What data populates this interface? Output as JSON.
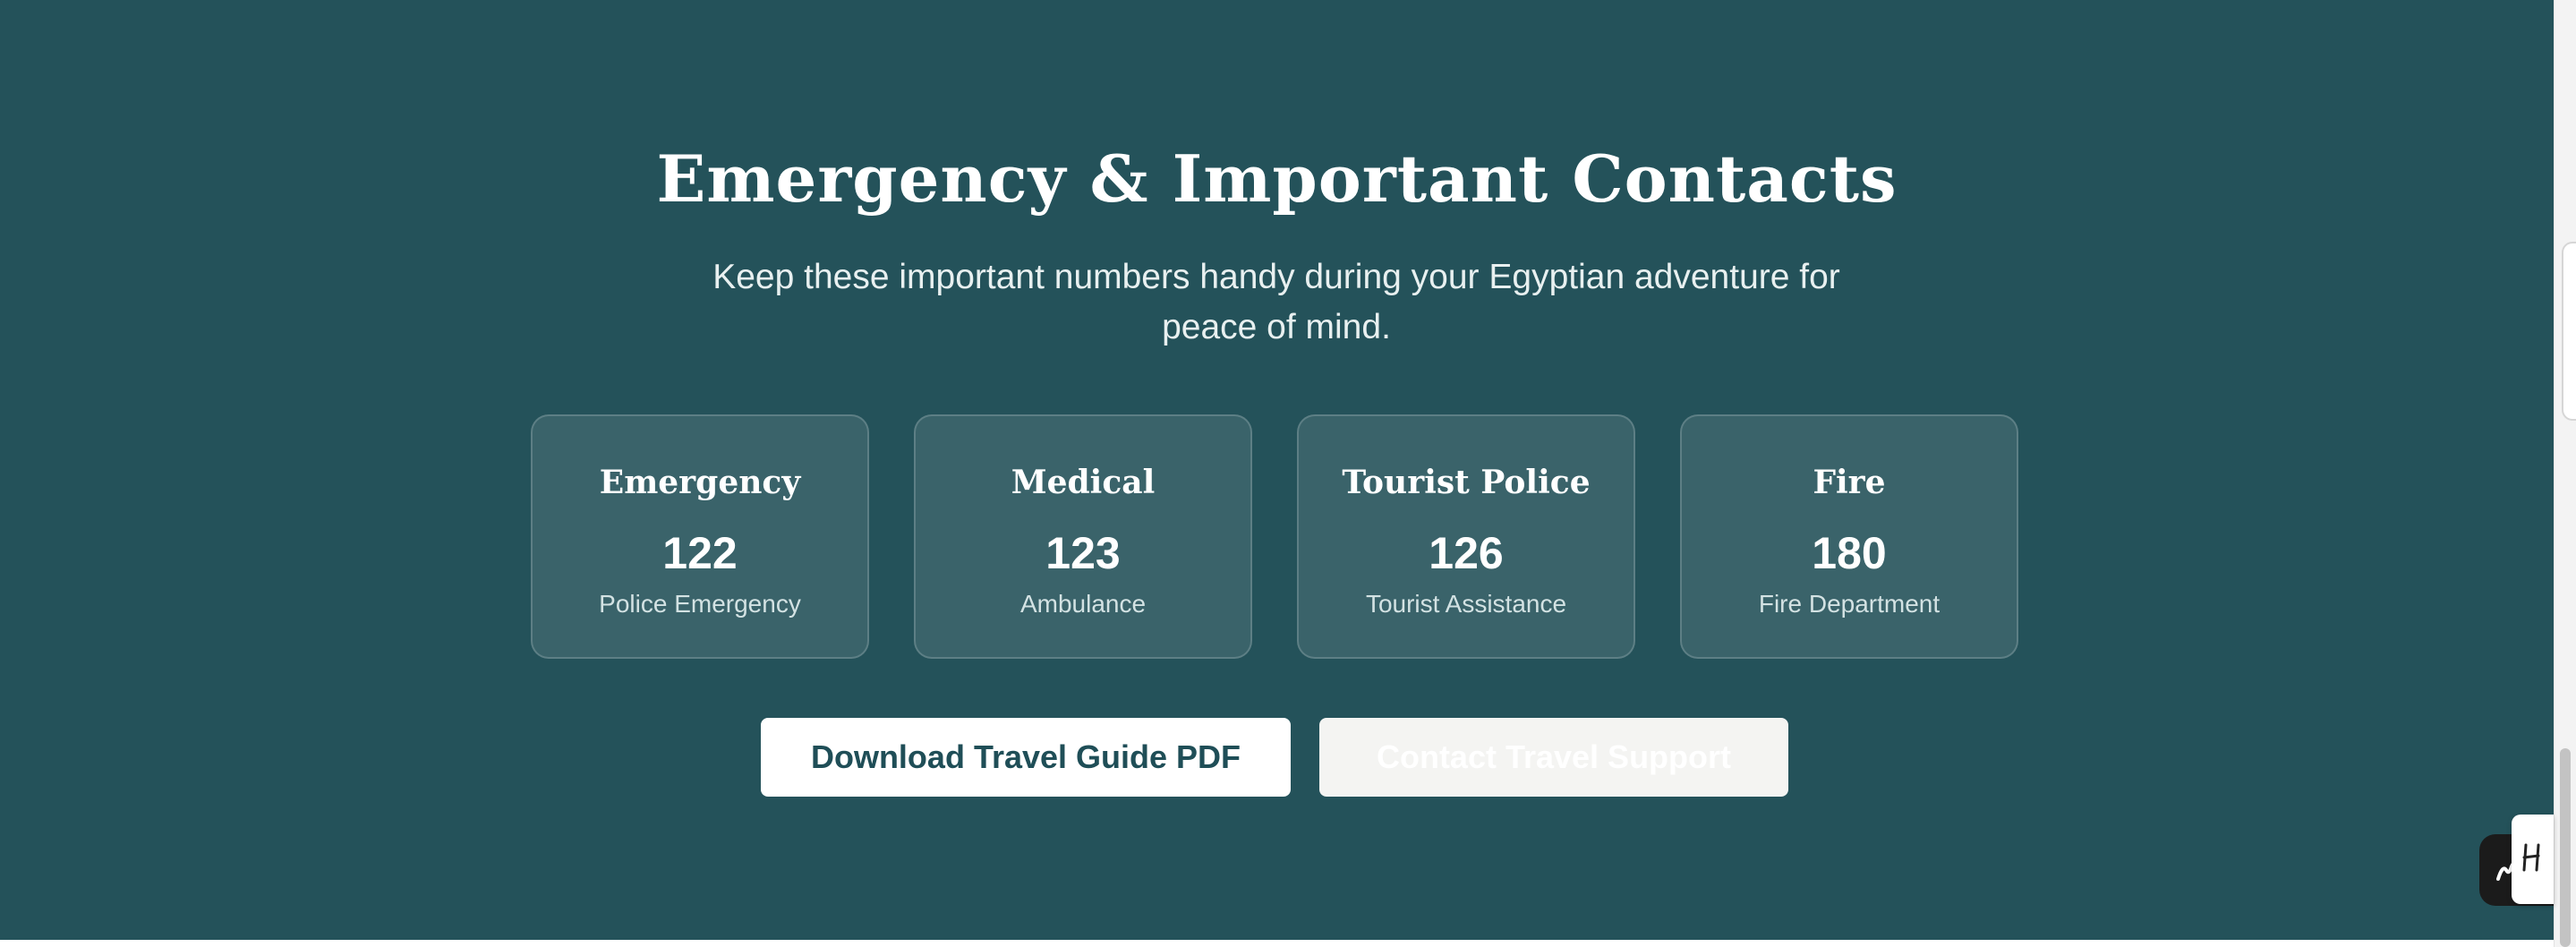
{
  "section": {
    "title": "Emergency & Important Contacts",
    "subtitle": "Keep these important numbers handy during your Egyptian adventure for peace of mind.",
    "background_color": "#24525a"
  },
  "contacts": [
    {
      "title": "Emergency",
      "number": "122",
      "description": "Police Emergency"
    },
    {
      "title": "Medical",
      "number": "123",
      "description": "Ambulance"
    },
    {
      "title": "Tourist Police",
      "number": "126",
      "description": "Tourist Assistance"
    },
    {
      "title": "Fire",
      "number": "180",
      "description": "Fire Department"
    }
  ],
  "actions": {
    "download_label": "Download Travel Guide PDF",
    "support_label": "Contact Travel Support"
  },
  "widget": {
    "icon": "signature-icon",
    "card_icon": "h-logo-icon"
  }
}
